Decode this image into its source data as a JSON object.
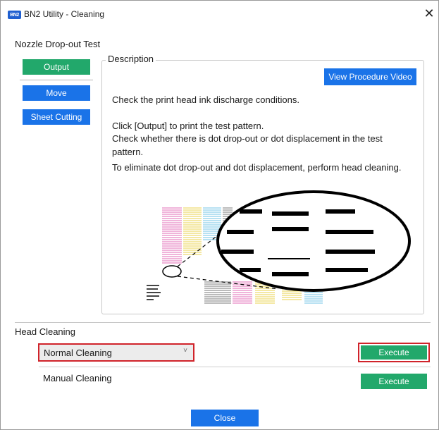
{
  "window": {
    "app_icon": "BN2",
    "title": "BN2 Utility - Cleaning",
    "close_glyph": "✕"
  },
  "nozzle_test": {
    "heading": "Nozzle Drop-out Test",
    "output_label": "Output",
    "move_label": "Move",
    "sheet_cutting_label": "Sheet Cutting"
  },
  "description": {
    "legend": "Description",
    "view_video_label": "View Procedure Video",
    "para1": "Check the print head ink discharge conditions.",
    "para2": "Click [Output] to print the test pattern.",
    "para3": "Check whether there is dot drop-out or dot displacement in the test pattern.",
    "para4": "To eliminate dot drop-out and dot displacement, perform head cleaning."
  },
  "head_cleaning": {
    "heading": "Head Cleaning",
    "cleaning_type_selected": "Normal Cleaning",
    "execute_label": "Execute",
    "manual_cleaning_label": "Manual Cleaning",
    "manual_execute_label": "Execute"
  },
  "footer": {
    "close_label": "Close"
  },
  "colors": {
    "green_button": "#22a86b",
    "blue_button": "#1a73e8",
    "highlight_red": "#d0232a",
    "pattern_colors": [
      "#e26ab4",
      "#e9d24a",
      "#6fc3e6",
      "#777777"
    ]
  }
}
